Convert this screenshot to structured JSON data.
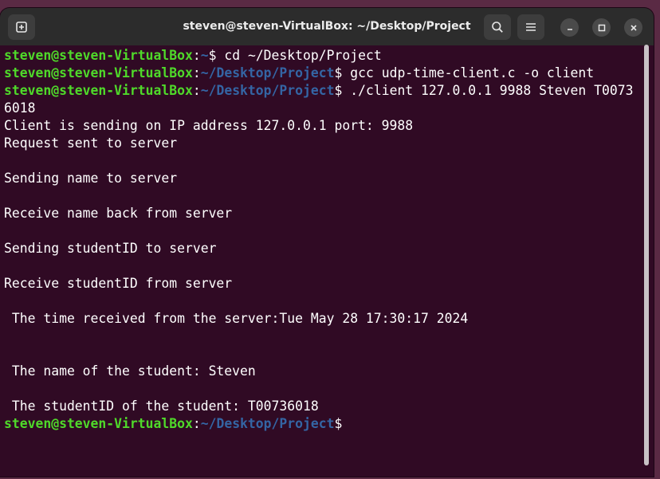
{
  "window": {
    "title": "steven@steven-VirtualBox: ~/Desktop/Project",
    "new_tab_icon": "new-tab-icon",
    "search_icon": "search-icon",
    "menu_icon": "hamburger-menu-icon",
    "minimize_icon": "minimize-icon",
    "maximize_icon": "maximize-icon",
    "close_icon": "close-icon"
  },
  "colors": {
    "terminal_bg": "#300a24",
    "prompt_user": "#4fd92a",
    "prompt_path": "#3465a4",
    "text": "#ffffff",
    "titlebar": "#2c2c2c"
  },
  "terminal": {
    "lines": [
      {
        "user": "steven@steven-VirtualBox",
        "sep": ":",
        "path": "~",
        "dollar": "$ ",
        "cmd": "cd ~/Desktop/Project"
      },
      {
        "user": "steven@steven-VirtualBox",
        "sep": ":",
        "path": "~/Desktop/Project",
        "dollar": "$ ",
        "cmd": "gcc udp-time-client.c -o client"
      },
      {
        "user": "steven@steven-VirtualBox",
        "sep": ":",
        "path": "~/Desktop/Project",
        "dollar": "$ ",
        "cmd": "./client 127.0.0.1 9988 Steven T0073"
      },
      {
        "text": "6018"
      },
      {
        "text": "Client is sending on IP address 127.0.0.1 port: 9988"
      },
      {
        "text": "Request sent to server"
      },
      {
        "text": ""
      },
      {
        "text": "Sending name to server"
      },
      {
        "text": ""
      },
      {
        "text": "Receive name back from server"
      },
      {
        "text": ""
      },
      {
        "text": "Sending studentID to server"
      },
      {
        "text": ""
      },
      {
        "text": "Receive studentID from server"
      },
      {
        "text": ""
      },
      {
        "text": " The time received from the server:Tue May 28 17:30:17 2024"
      },
      {
        "text": ""
      },
      {
        "text": ""
      },
      {
        "text": " The name of the student: Steven"
      },
      {
        "text": ""
      },
      {
        "text": " The studentID of the student: T00736018"
      },
      {
        "user": "steven@steven-VirtualBox",
        "sep": ":",
        "path": "~/Desktop/Project",
        "dollar": "$",
        "cmd": ""
      }
    ]
  }
}
